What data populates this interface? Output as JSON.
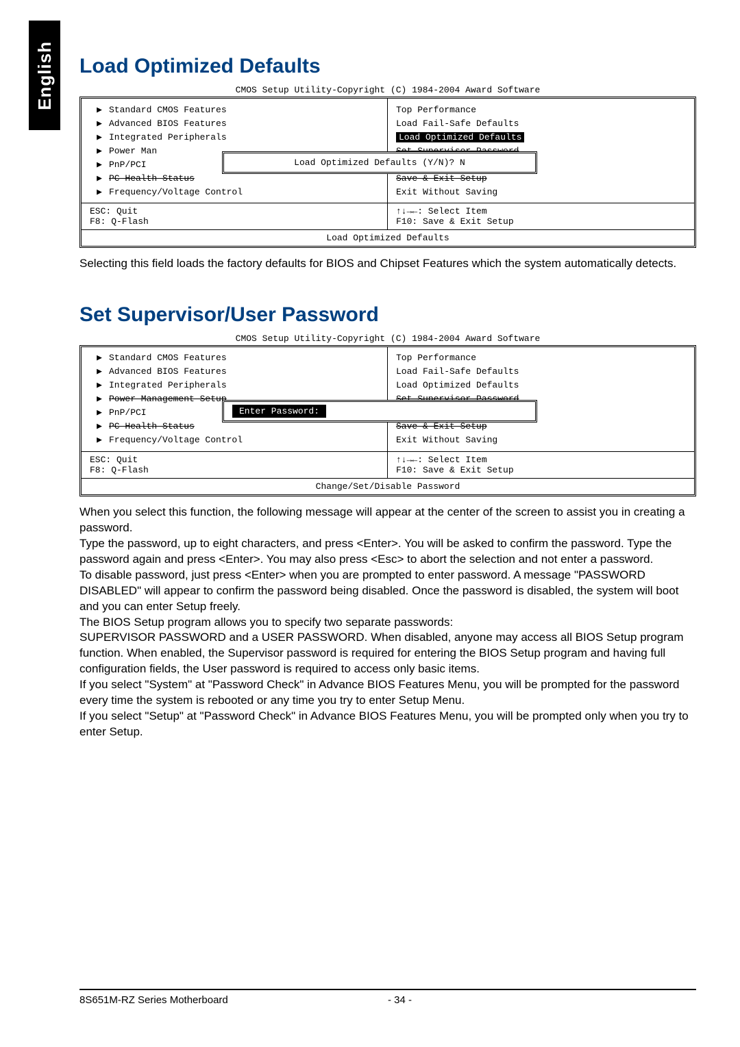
{
  "side_tab": "English",
  "section1": {
    "heading": "Load Optimized Defaults",
    "bios_caption": "CMOS Setup Utility-Copyright (C) 1984-2004 Award Software",
    "left_items": [
      "Standard CMOS Features",
      "Advanced BIOS Features",
      "Integrated Peripherals",
      "Power Man",
      "PnP/PCI",
      "PC Health Status",
      "Frequency/Voltage Control"
    ],
    "right_items": [
      "Top Performance",
      "Load Fail-Safe Defaults",
      "Load Optimized Defaults",
      "Set Supervisor Password",
      "",
      "Save & Exit Setup",
      "Exit Without Saving"
    ],
    "popup_text": "Load Optimized Defaults (Y/N)? N",
    "hint_esc": "ESC: Quit",
    "hint_select": "↑↓→←: Select Item",
    "hint_f8": "F8: Q-Flash",
    "hint_f10": "F10: Save & Exit Setup",
    "footer": "Load Optimized Defaults",
    "body": "Selecting this field loads the factory defaults for BIOS and Chipset Features which the system automatically detects."
  },
  "section2": {
    "heading": "Set Supervisor/User Password",
    "bios_caption": "CMOS Setup Utility-Copyright (C) 1984-2004 Award Software",
    "left_items": [
      "Standard CMOS Features",
      "Advanced BIOS Features",
      "Integrated Peripherals",
      "Power Management Setup",
      "PnP/PCI",
      "PC Health Status",
      "Frequency/Voltage Control"
    ],
    "right_items": [
      "Top Performance",
      "Load Fail-Safe Defaults",
      "Load Optimized Defaults",
      "Set Supervisor Password",
      "",
      "Save & Exit Setup",
      "Exit Without Saving"
    ],
    "popup_label": "Enter Password:",
    "hint_esc": "ESC: Quit",
    "hint_select": "↑↓→←: Select Item",
    "hint_f8": "F8: Q-Flash",
    "hint_f10": "F10: Save & Exit Setup",
    "footer": "Change/Set/Disable Password",
    "body_p1": "When you select this function, the following message will appear at the center of the screen to assist you in creating a password.",
    "body_p2": "Type the password, up to eight characters, and press <Enter>. You will be asked to confirm the password. Type the password again and press <Enter>. You may also press <Esc> to abort the selection and not enter a password.",
    "body_p3": "To disable password, just press <Enter> when you are prompted to enter password. A message \"PASSWORD DISABLED\" will appear to confirm the password being disabled. Once the password is disabled, the system will boot and you can enter Setup freely.",
    "body_p4": "The BIOS Setup program allows you to specify two separate passwords:",
    "body_p5": "SUPERVISOR PASSWORD and a USER PASSWORD. When disabled, anyone may access all BIOS Setup program function. When enabled, the Supervisor password is required for entering the BIOS Setup program and having full configuration fields, the User password is required to access only basic items.",
    "body_p6": "If you select \"System\" at \"Password Check\" in Advance BIOS Features Menu, you will be prompted for the password every time the system is rebooted or any time you try to enter Setup Menu.",
    "body_p7": "If you select \"Setup\" at \"Password Check\" in Advance BIOS Features Menu, you will be prompted only when you try to enter Setup."
  },
  "page_footer": {
    "left": "8S651M-RZ Series Motherboard",
    "mid": "- 34 -"
  }
}
